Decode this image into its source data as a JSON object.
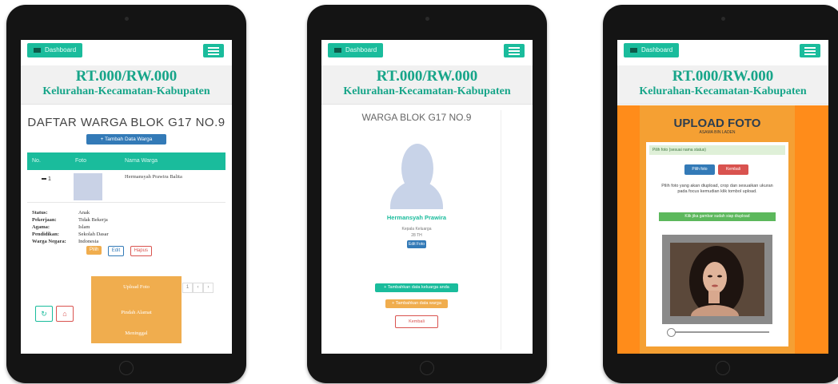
{
  "header": {
    "dashboard_label": "Dashboard",
    "rt_rw": "RT.000/RW.000",
    "kelurahan": "Kelurahan-Kecamatan-Kabupaten"
  },
  "screen1": {
    "title": "DAFTAR WARGA BLOK G17 NO.9",
    "add_button": "+ Tambah Data Warga",
    "columns": [
      "No.",
      "Foto",
      "Nama Warga"
    ],
    "row": {
      "no": "1",
      "name": "Hermansyah Prawira Balita"
    },
    "details": [
      {
        "key": "Status:",
        "value": "Anak"
      },
      {
        "key": "Pekerjaan:",
        "value": "Tidak Bekerja"
      },
      {
        "key": "Agama:",
        "value": "Islam"
      },
      {
        "key": "Pendidikan:",
        "value": "Sekolah Dasar"
      },
      {
        "key": "Warga Negara:",
        "value": "Indonesia"
      }
    ],
    "btn_pilih": "Pilih",
    "btn_edit": "Edit",
    "btn_hapus": "Hapus",
    "dropdown": [
      "Upload Foto",
      "Pindah Alamat",
      "Meninggal"
    ],
    "pager": [
      "1",
      "‹",
      "›"
    ]
  },
  "screen2": {
    "title": "WARGA BLOK G17 NO.9",
    "name": "Hermansyah Prawira",
    "role": "Kepala Keluarga",
    "age": "28 TH",
    "edit_foto": "Edit Foto",
    "btn_tambah_keluarga": "+ Tambahkan data keluarga anda",
    "btn_tambahkan": "+ Tambahkan data warga",
    "btn_kembali": "Kembali"
  },
  "screen3": {
    "title": "UPLOAD FOTO",
    "subtitle": "ASAMA BIN LADEN",
    "alert": "Pilih foto (sesuai nama status)",
    "btn_pilih_foto": "Pilih foto",
    "btn_kembali": "Kembali",
    "description": "Pilih foto yang akan diupload, crop dan sesuaikan ukuran pada focus kemudian klik tombol upload.",
    "crop_button": "Klik jika gambar sudah siap diupload"
  },
  "colors": {
    "accent": "#1abc9c",
    "primary": "#337ab7",
    "warning": "#f0ad4e",
    "danger": "#d9534f",
    "success": "#5cb85c",
    "orange": "#ff8c1a"
  },
  "icons": [
    "dashboard-icon",
    "menu-icon",
    "refresh-icon",
    "home-icon",
    "upload-icon",
    "user-icon"
  ]
}
